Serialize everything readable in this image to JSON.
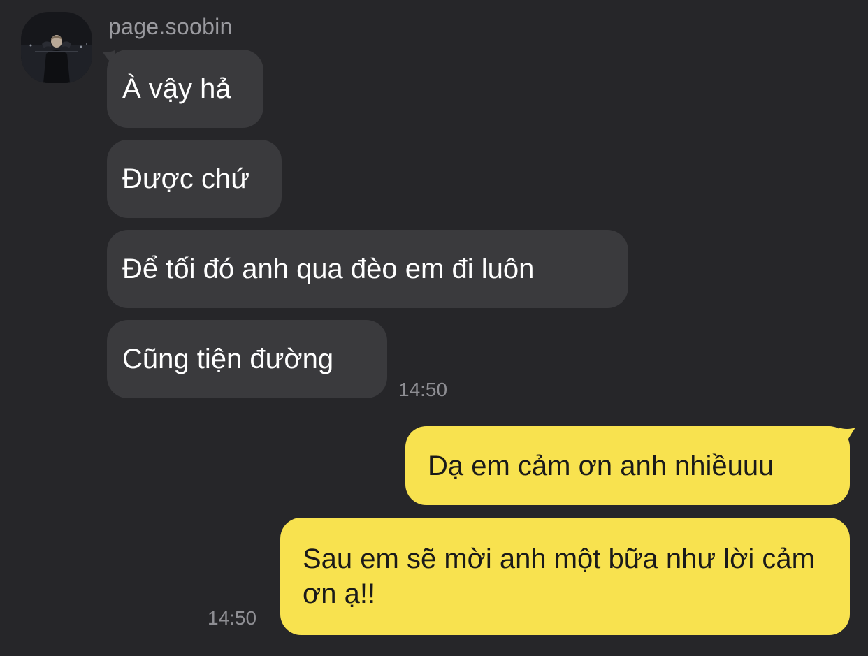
{
  "conversation": {
    "sender_name": "page.soobin",
    "incoming": [
      {
        "text": "À vậy hả"
      },
      {
        "text": "Được chứ"
      },
      {
        "text": "Để tối đó anh qua đèo em đi luôn"
      },
      {
        "text": "Cũng tiện đường"
      }
    ],
    "incoming_time": "14:50",
    "outgoing": [
      {
        "text": "Dạ em cảm ơn anh nhiềuuu"
      },
      {
        "text": "Sau em sẽ mời anh một bữa như lời cảm ơn ạ!!"
      }
    ],
    "outgoing_time": "14:50"
  },
  "colors": {
    "background": "#262629",
    "incoming_bubble": "#3a3a3d",
    "outgoing_bubble": "#f8e24f"
  },
  "icons": {
    "avatar": "profile-photo-avatar"
  }
}
